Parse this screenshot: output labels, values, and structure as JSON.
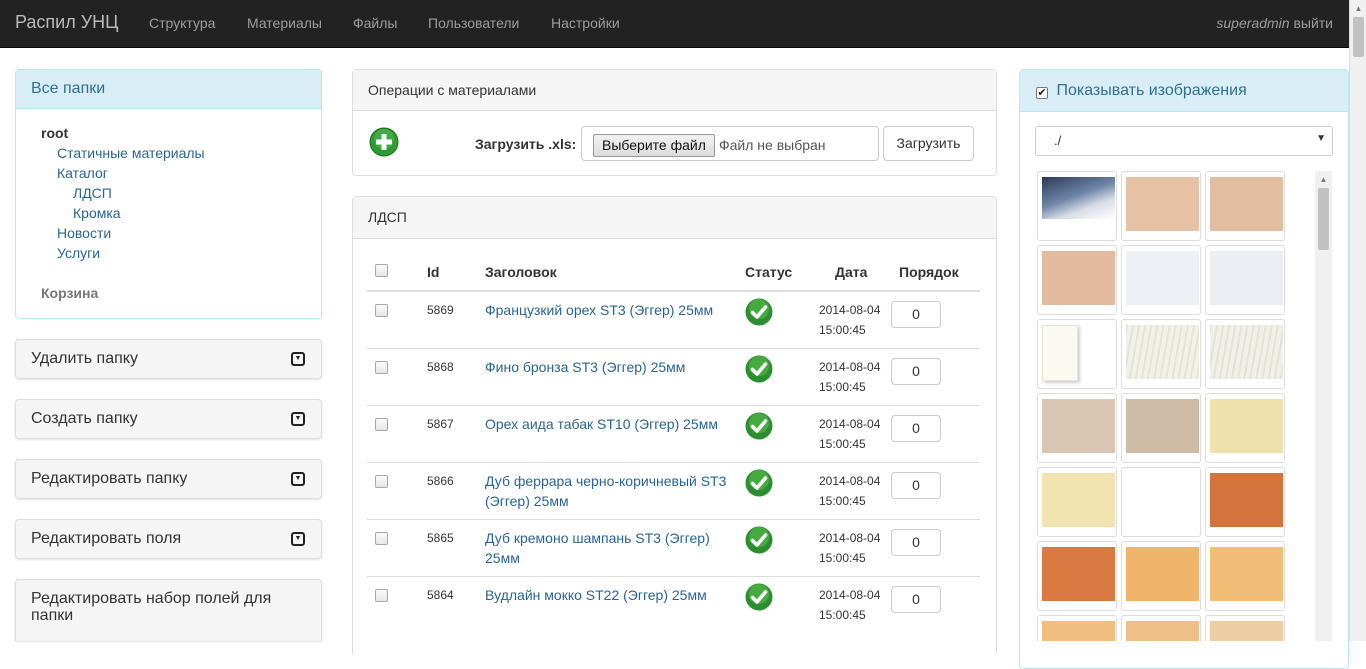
{
  "navbar": {
    "brand": "Распил УНЦ",
    "items": [
      {
        "label": "Структура"
      },
      {
        "label": "Материалы"
      },
      {
        "label": "Файлы"
      },
      {
        "label": "Пользователи"
      },
      {
        "label": "Настройки"
      }
    ],
    "user": "superadmin",
    "logout": "выйти"
  },
  "sidebar": {
    "folders_title": "Все папки",
    "tree": [
      {
        "label": "root",
        "level": 0,
        "bold": true
      },
      {
        "label": "Статичные материалы",
        "level": 1
      },
      {
        "label": "Каталог",
        "level": 1
      },
      {
        "label": "ЛДСП",
        "level": 2
      },
      {
        "label": "Кромка",
        "level": 2
      },
      {
        "label": "Новости",
        "level": 1
      },
      {
        "label": "Услуги",
        "level": 1
      }
    ],
    "basket": "Корзина",
    "accordions": [
      {
        "label": "Удалить папку"
      },
      {
        "label": "Создать папку"
      },
      {
        "label": "Редактировать папку"
      },
      {
        "label": "Редактировать поля"
      },
      {
        "label": "Редактировать набор полей для папки"
      }
    ]
  },
  "operations": {
    "title": "Операции с материалами",
    "upload_label": "Загрузить .xls:",
    "choose_file": "Выберите файл",
    "no_file": "Файл не выбран",
    "upload_button": "Загрузить"
  },
  "table": {
    "section_title": "ЛДСП",
    "columns": {
      "id": "Id",
      "title": "Заголовок",
      "status": "Статус",
      "date": "Дата",
      "order": "Порядок"
    },
    "rows": [
      {
        "id": "5869",
        "title": "Французкий орех ST3 (Эггер) 25мм",
        "date": "2014-08-04",
        "time": "15:00:45",
        "order": "0"
      },
      {
        "id": "5868",
        "title": "Фино бронза ST3 (Эггер) 25мм",
        "date": "2014-08-04",
        "time": "15:00:45",
        "order": "0"
      },
      {
        "id": "5867",
        "title": "Орех аида табак ST10 (Эггер) 25мм",
        "date": "2014-08-04",
        "time": "15:00:45",
        "order": "0"
      },
      {
        "id": "5866",
        "title": "Дуб феррара черно-коричневый ST3 (Эггер) 25мм",
        "date": "2014-08-04",
        "time": "15:00:45",
        "order": "0"
      },
      {
        "id": "5865",
        "title": "Дуб кремоно шампань ST3 (Эггер) 25мм",
        "date": "2014-08-04",
        "time": "15:00:45",
        "order": "0"
      },
      {
        "id": "5864",
        "title": "Вудлайн мокко ST22 (Эггер) 25мм",
        "date": "2014-08-04",
        "time": "15:00:45",
        "order": "0"
      }
    ]
  },
  "images_panel": {
    "show_images": "Показывать изображения",
    "path": "./",
    "thumb_colors": [
      "#5b6f8a",
      "#e6c1a4",
      "#e4bea0",
      "#e2bb9e",
      "#eef0f5",
      "#eceef3",
      "#fbfaf2",
      "#f1f1e8",
      "#f0f0e8",
      "#d8c6b2",
      "#d0bca6",
      "#efe0ad",
      "#f1e4b1",
      "#ffffff",
      "#d4743c",
      "#d97a42",
      "#f0b46a",
      "#f2bd76",
      "#f0be80",
      "#eebf88",
      "#eccda4"
    ]
  }
}
